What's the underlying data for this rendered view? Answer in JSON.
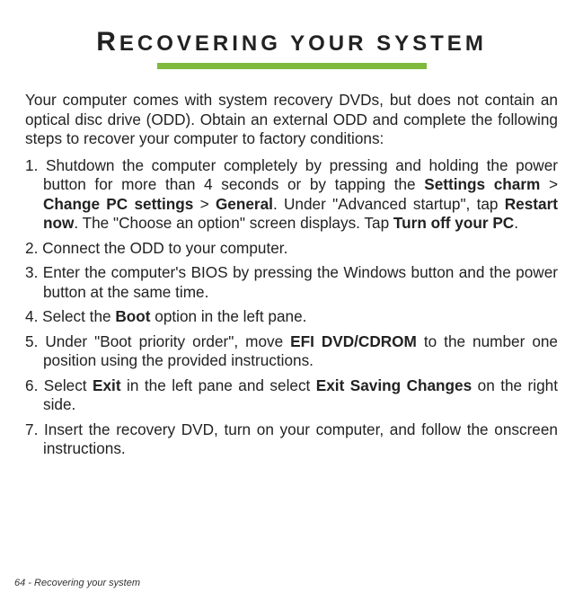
{
  "title_first": "R",
  "title_rest": "ECOVERING YOUR SYSTEM",
  "intro": "Your computer comes with system recovery DVDs, but does not contain an optical disc drive (ODD). Obtain an external ODD and complete the following steps to recover your computer to factory conditions:",
  "steps": [
    {
      "parts": [
        {
          "t": "Shutdown the computer completely by pressing and holding the power button for more than 4 seconds or by tapping the ",
          "b": false
        },
        {
          "t": "Settings charm",
          "b": true
        },
        {
          "t": " > ",
          "b": false
        },
        {
          "t": "Change PC settings",
          "b": true
        },
        {
          "t": " > ",
          "b": false
        },
        {
          "t": "General",
          "b": true
        },
        {
          "t": ". Under \"Advanced startup\", tap ",
          "b": false
        },
        {
          "t": "Restart now",
          "b": true
        },
        {
          "t": ". The \"Choose an option\" screen displays. Tap ",
          "b": false
        },
        {
          "t": "Turn off your PC",
          "b": true
        },
        {
          "t": ".",
          "b": false
        }
      ]
    },
    {
      "parts": [
        {
          "t": "Connect the ODD to your computer.",
          "b": false
        }
      ]
    },
    {
      "parts": [
        {
          "t": "Enter the computer's BIOS by pressing the Windows button and the power button at the same time.",
          "b": false
        }
      ]
    },
    {
      "parts": [
        {
          "t": "Select the ",
          "b": false
        },
        {
          "t": "Boot",
          "b": true
        },
        {
          "t": " option in the left pane.",
          "b": false
        }
      ]
    },
    {
      "parts": [
        {
          "t": "Under \"Boot priority order\", move ",
          "b": false
        },
        {
          "t": "EFI DVD/CDROM",
          "b": true
        },
        {
          "t": " to the number one position using the provided instructions.",
          "b": false
        }
      ]
    },
    {
      "parts": [
        {
          "t": "Select ",
          "b": false
        },
        {
          "t": "Exit",
          "b": true
        },
        {
          "t": " in the left pane and select ",
          "b": false
        },
        {
          "t": "Exit Saving Changes",
          "b": true
        },
        {
          "t": " on the right side.",
          "b": false
        }
      ]
    },
    {
      "parts": [
        {
          "t": "Insert the recovery DVD, turn on your computer, and follow the onscreen instructions.",
          "b": false
        }
      ]
    }
  ],
  "footer": "64 - Recovering your system"
}
